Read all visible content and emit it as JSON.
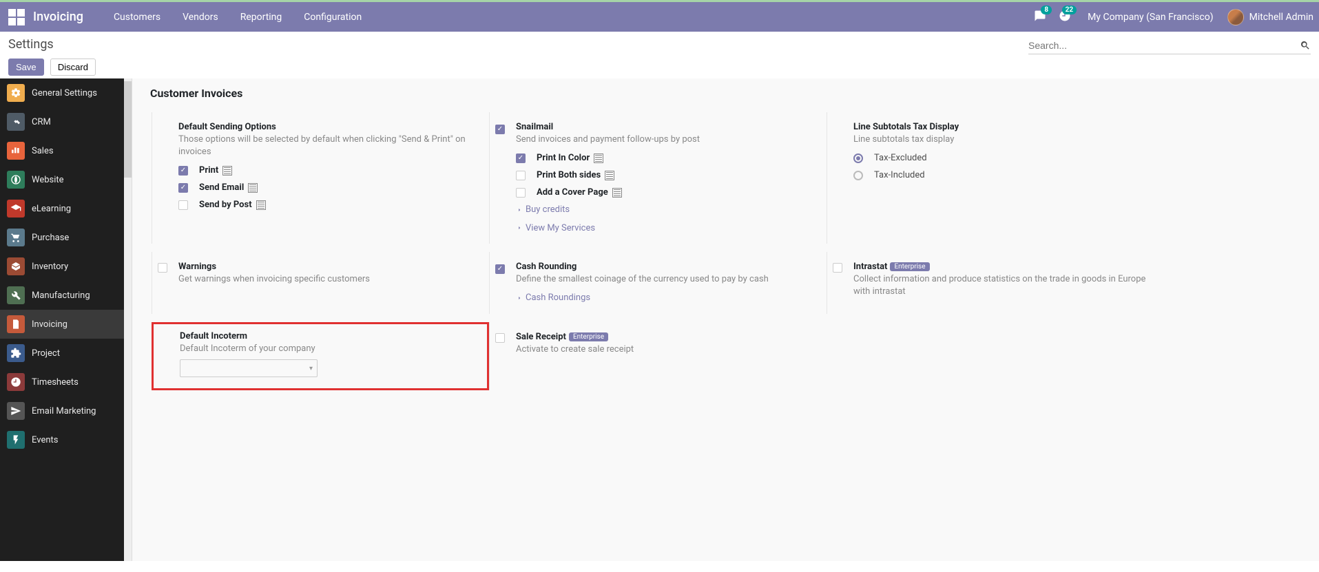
{
  "navbar": {
    "brand": "Invoicing",
    "menu": [
      "Customers",
      "Vendors",
      "Reporting",
      "Configuration"
    ],
    "msg_count": "8",
    "activity_count": "22",
    "company": "My Company (San Francisco)",
    "user": "Mitchell Admin"
  },
  "page": {
    "title": "Settings",
    "save": "Save",
    "discard": "Discard",
    "search_placeholder": "Search..."
  },
  "sidebar": {
    "items": [
      {
        "label": "General Settings",
        "color": "#f0ad4e",
        "icon": "gear"
      },
      {
        "label": "CRM",
        "color": "#4f5b66",
        "icon": "handshake"
      },
      {
        "label": "Sales",
        "color": "#e8643c",
        "icon": "chart"
      },
      {
        "label": "Website",
        "color": "#2e7d5b",
        "icon": "globe"
      },
      {
        "label": "eLearning",
        "color": "#c0392b",
        "icon": "grad"
      },
      {
        "label": "Purchase",
        "color": "#5b7a8c",
        "icon": "cart"
      },
      {
        "label": "Inventory",
        "color": "#9b4b34",
        "icon": "box"
      },
      {
        "label": "Manufacturing",
        "color": "#4f6f52",
        "icon": "wrench"
      },
      {
        "label": "Invoicing",
        "color": "#c55a3b",
        "icon": "invoice",
        "active": true
      },
      {
        "label": "Project",
        "color": "#3b5b8c",
        "icon": "puzzle"
      },
      {
        "label": "Timesheets",
        "color": "#8b3a3a",
        "icon": "clock"
      },
      {
        "label": "Email Marketing",
        "color": "#555555",
        "icon": "send"
      },
      {
        "label": "Events",
        "color": "#1f6f6f",
        "icon": "bolt"
      }
    ]
  },
  "section": {
    "title": "Customer Invoices"
  },
  "settings": {
    "default_sending": {
      "title": "Default Sending Options",
      "sub": "Those options will be selected by default when clicking \"Send & Print\" on invoices",
      "print": "Print",
      "send_email": "Send Email",
      "send_post": "Send by Post"
    },
    "snailmail": {
      "title": "Snailmail",
      "sub": "Send invoices and payment follow-ups by post",
      "print_color": "Print In Color",
      "print_both": "Print Both sides",
      "add_cover": "Add a Cover Page",
      "buy_credits": "Buy credits",
      "view_services": "View My Services"
    },
    "tax_display": {
      "title": "Line Subtotals Tax Display",
      "sub": "Line subtotals tax display",
      "excluded": "Tax-Excluded",
      "included": "Tax-Included"
    },
    "warnings": {
      "title": "Warnings",
      "sub": "Get warnings when invoicing specific customers"
    },
    "cash_rounding": {
      "title": "Cash Rounding",
      "sub": "Define the smallest coinage of the currency used to pay by cash",
      "link": "Cash Roundings"
    },
    "intrastat": {
      "title": "Intrastat",
      "badge": "Enterprise",
      "sub": "Collect information and produce statistics on the trade in goods in Europe with intrastat"
    },
    "default_incoterm": {
      "title": "Default Incoterm",
      "sub": "Default Incoterm of your company"
    },
    "sale_receipt": {
      "title": "Sale Receipt",
      "badge": "Enterprise",
      "sub": "Activate to create sale receipt"
    }
  }
}
